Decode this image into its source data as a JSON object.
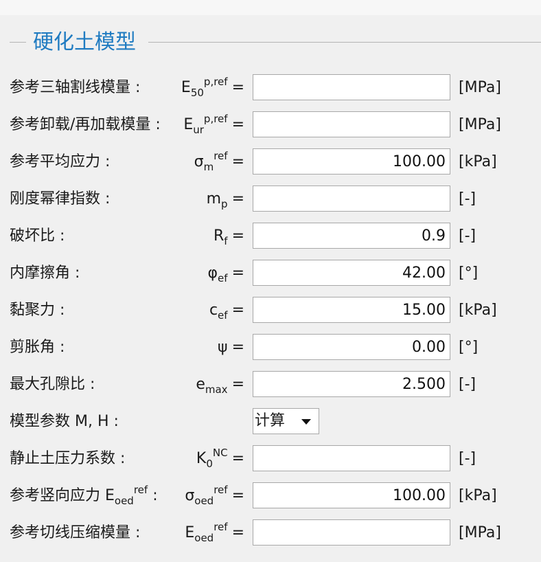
{
  "group": {
    "title": "硬化土模型"
  },
  "rows": [
    {
      "label": "参考三轴割线模量 :",
      "sym_main": "E",
      "sym_sub": "50",
      "sym_sup": "p,ref",
      "eq": "=",
      "value": "",
      "unit": "[MPa]"
    },
    {
      "label": "参考卸载/再加载模量 :",
      "sym_main": "E",
      "sym_sub": "ur",
      "sym_sup": "p,ref",
      "eq": "=",
      "value": "",
      "unit": "[MPa]"
    },
    {
      "label": "参考平均应力 :",
      "sym_main": "σ",
      "sym_sub": "m",
      "sym_sup": "ref",
      "eq": "=",
      "value": "100.00",
      "unit": "[kPa]"
    },
    {
      "label": "刚度幂律指数 :",
      "sym_main": "m",
      "sym_sub": "p",
      "sym_sup": "",
      "eq": "=",
      "value": "",
      "unit": "[-]"
    },
    {
      "label": "破坏比 :",
      "sym_main": "R",
      "sym_sub": "f",
      "sym_sup": "",
      "eq": "=",
      "value": "0.9",
      "unit": "[-]"
    },
    {
      "label": "内摩擦角 :",
      "sym_main": "φ",
      "sym_sub": "ef",
      "sym_sup": "",
      "eq": "=",
      "value": "42.00",
      "unit": "[°]"
    },
    {
      "label": "黏聚力 :",
      "sym_main": "c",
      "sym_sub": "ef",
      "sym_sup": "",
      "eq": "=",
      "value": "15.00",
      "unit": "[kPa]"
    },
    {
      "label": "剪胀角 :",
      "sym_main": "ψ",
      "sym_sub": "",
      "sym_sup": "",
      "eq": "=",
      "value": "0.00",
      "unit": "[°]"
    },
    {
      "label": "最大孔隙比 :",
      "sym_main": "e",
      "sym_sub": "max",
      "sym_sup": "",
      "eq": "=",
      "value": "2.500",
      "unit": "[-]"
    },
    {
      "label": "模型参数 M, H :",
      "select_value": "计算"
    },
    {
      "label": "静止土压力系数 :",
      "sym_main": "K",
      "sym_sub": "0",
      "sym_sup": "NC",
      "eq": "=",
      "value": "",
      "unit": "[-]"
    },
    {
      "label": "参考竖向应力 E",
      "label_sub": "oed",
      "label_sup": "ref",
      "label_tail": " :",
      "sym_main": "σ",
      "sym_sub": "oed",
      "sym_sup": "ref",
      "eq": "=",
      "value": "100.00",
      "unit": "[kPa]"
    },
    {
      "label": "参考切线压缩模量 :",
      "sym_main": "E",
      "sym_sub": "oed",
      "sym_sup": "ref",
      "eq": "=",
      "value": "",
      "unit": "[MPa]"
    }
  ]
}
